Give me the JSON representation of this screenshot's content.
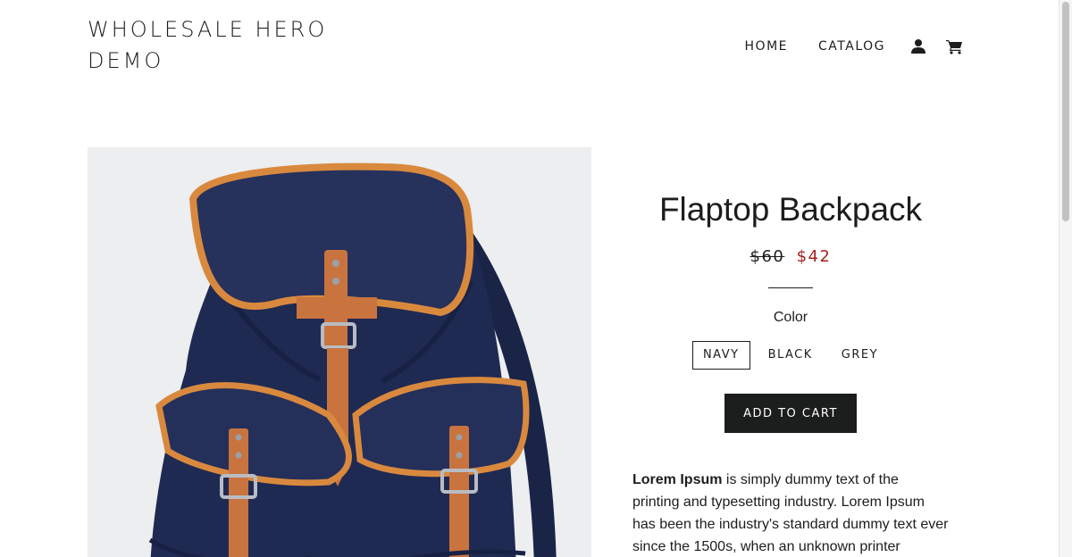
{
  "header": {
    "site_title": "Wholesale Hero Demo",
    "nav": {
      "home": "Home",
      "catalog": "Catalog",
      "account_icon": "person-icon",
      "cart_icon": "cart-icon"
    }
  },
  "product": {
    "image_alt": "Navy canvas backpack with tan leather trim",
    "title": "Flaptop Backpack",
    "compare_price": "$60",
    "sale_price": "$42",
    "option_label": "Color",
    "options": [
      "Navy",
      "Black",
      "Grey"
    ],
    "selected_option": "Navy",
    "add_to_cart": "Add to Cart",
    "description_bold": "Lorem Ipsum",
    "description_text": " is simply dummy text of the printing and typesetting industry. Lorem Ipsum has been the industry's standard dummy text ever since the 1500s, when an unknown printer"
  },
  "colors": {
    "text": "#1c1d1d",
    "sale": "#a6201f",
    "button_bg": "#1c1d1d",
    "button_text": "#ffffff",
    "backpack_navy": "#1f2a52",
    "leather_trim": "#d9893e",
    "strap": "#c9743f"
  }
}
